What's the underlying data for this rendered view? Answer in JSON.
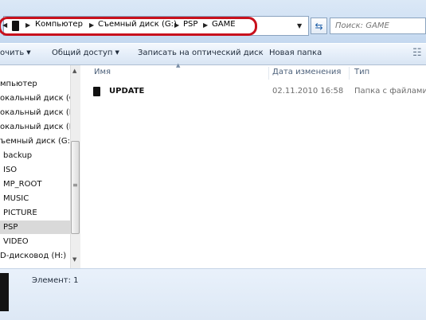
{
  "address_bar": {
    "crumbs": [
      "Компьютер",
      "Съемный диск (G:)",
      "PSP",
      "GAME"
    ],
    "search_placeholder": "Поиск: GAME"
  },
  "toolbar": {
    "organize_label": "очить",
    "share_label": "Общий доступ",
    "burn_label": "Записать на оптический диск",
    "new_folder_label": "Новая папка"
  },
  "nav_pane": {
    "items": [
      {
        "label": "мпьютер"
      },
      {
        "label": "окальный диск (C"
      },
      {
        "label": "окальный диск (D"
      },
      {
        "label": "окальный диск (E"
      },
      {
        "label": "ъемный диск (G:)"
      },
      {
        "label": "backup"
      },
      {
        "label": "ISO"
      },
      {
        "label": "MP_ROOT"
      },
      {
        "label": "MUSIC"
      },
      {
        "label": "PICTURE"
      },
      {
        "label": "PSP",
        "selected": true
      },
      {
        "label": "VIDEO"
      },
      {
        "label": "D-дисковод (H:)"
      }
    ]
  },
  "file_list": {
    "columns": [
      "Имя",
      "Дата изменения",
      "Тип"
    ],
    "rows": [
      {
        "name": "UPDATE",
        "date": "02.11.2010 16:58",
        "type": "Папка с файлами"
      }
    ]
  },
  "details_pane": {
    "item_count": "Элемент: 1"
  },
  "colors": {
    "highlight_ring": "#c8111d",
    "chrome_blue": "#d6e4f4",
    "selected_bg": "#d9d9d9"
  }
}
